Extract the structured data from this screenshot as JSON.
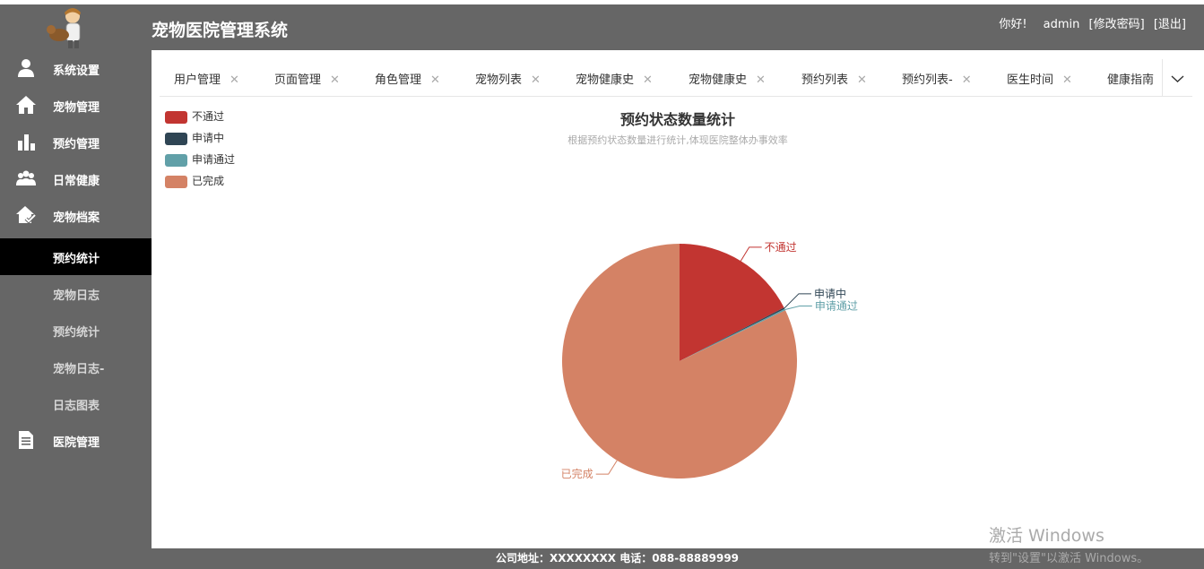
{
  "header": {
    "title": "宠物医院管理系统",
    "greeting": "你好!",
    "user": "admin",
    "change_password": "[修改密码]",
    "logout": "[退出]"
  },
  "sidebar": {
    "items": [
      {
        "label": "系统设置",
        "icon": "user-gear-icon"
      },
      {
        "label": "宠物管理",
        "icon": "home-icon"
      },
      {
        "label": "预约管理",
        "icon": "bar-chart-icon"
      },
      {
        "label": "日常健康",
        "icon": "group-icon"
      },
      {
        "label": "宠物档案",
        "icon": "house-check-icon"
      }
    ],
    "sub_items": [
      {
        "label": "预约统计",
        "active": true
      },
      {
        "label": "宠物日志",
        "active": false
      },
      {
        "label": "预约统计",
        "active": false
      },
      {
        "label": "宠物日志-",
        "active": false
      },
      {
        "label": "日志图表",
        "active": false
      }
    ],
    "last_item": {
      "label": "医院管理",
      "icon": "document-icon"
    }
  },
  "tabs": [
    {
      "label": "用户管理"
    },
    {
      "label": "页面管理"
    },
    {
      "label": "角色管理"
    },
    {
      "label": "宠物列表"
    },
    {
      "label": "宠物健康史"
    },
    {
      "label": "宠物健康史"
    },
    {
      "label": "预约列表"
    },
    {
      "label": "预约列表-"
    },
    {
      "label": "医生时间"
    },
    {
      "label": "健康指南"
    }
  ],
  "tab_close_glyph": "✕",
  "chart_data": {
    "type": "pie",
    "title": "预约状态数量统计",
    "subtitle": "根据预约状态数量进行统计,体现医院整体办事效率",
    "legend_position": "top-left",
    "slices": [
      {
        "name": "不通过",
        "value": 17,
        "color": "#c23531"
      },
      {
        "name": "申请中",
        "value": 0.2,
        "color": "#2f4554"
      },
      {
        "name": "申请通过",
        "value": 0.2,
        "color": "#61a0a8"
      },
      {
        "name": "已完成",
        "value": 80,
        "color": "#d48265"
      }
    ]
  },
  "footer": {
    "text": "公司地址：XXXXXXXX 电话：088-88889999"
  },
  "watermark": {
    "line1": "激活 Windows",
    "line2": "转到\"设置\"以激活 Windows。"
  }
}
